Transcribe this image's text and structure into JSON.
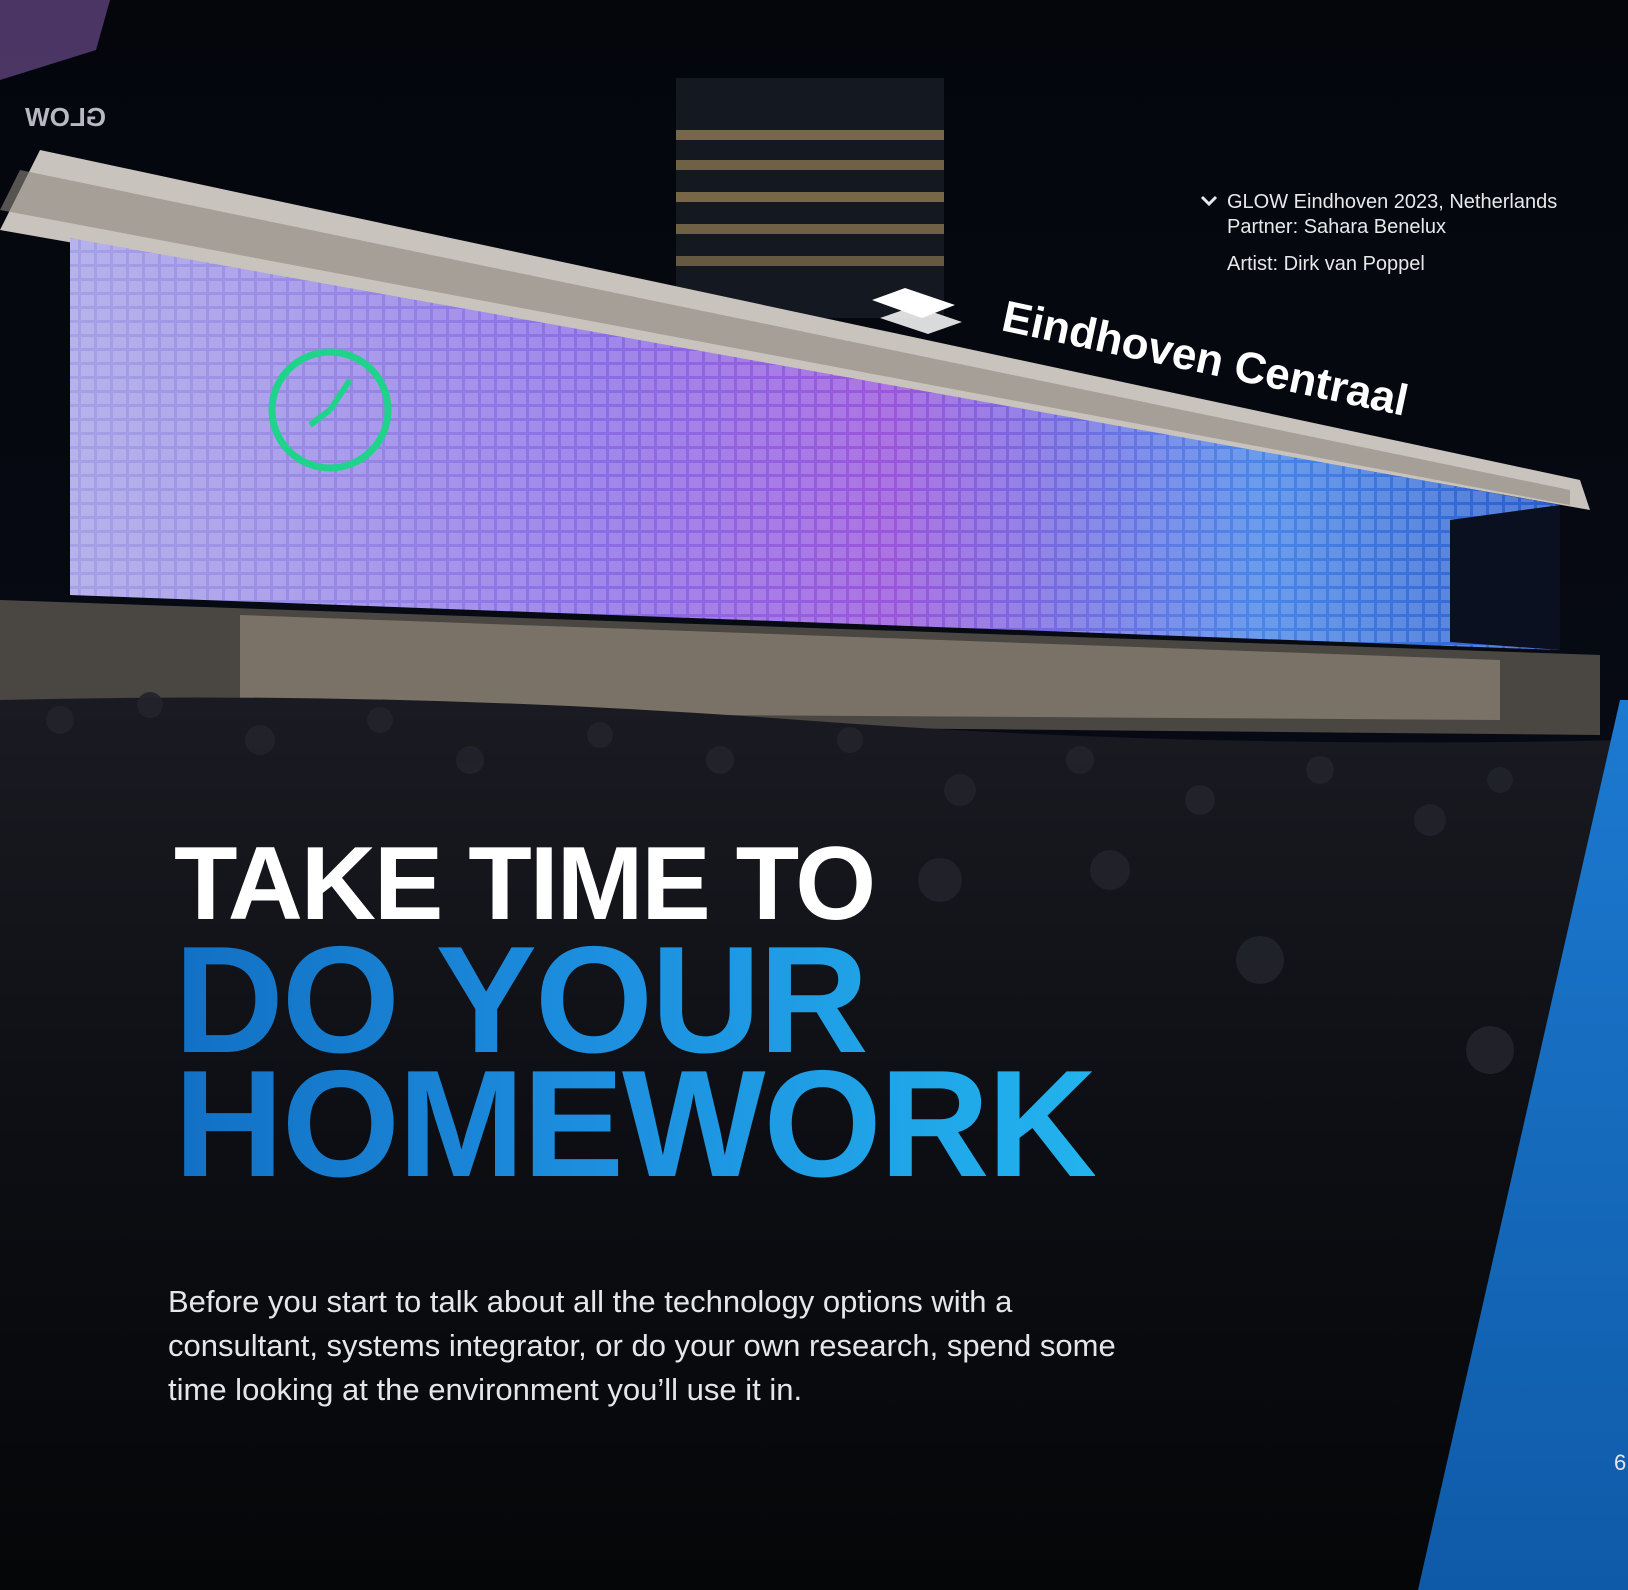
{
  "caption": {
    "line1": "GLOW Eindhoven 2023, Netherlands",
    "line2": "Partner: Sahara Benelux",
    "line3": "Artist: Dirk van Poppel"
  },
  "photo": {
    "station_sign": "Eindhoven Centraal",
    "glow_logo": "GLOW"
  },
  "headline": {
    "line1": "TAKE TIME TO",
    "line2": "DO YOUR",
    "line3": "HOMEWORK"
  },
  "body": "Before you start to talk about all the technology options with a consultant, systems integrator, or do your own research, spend some time looking at the environment you’ll use it in.",
  "page_number": "6",
  "colors": {
    "accent_blue": "#1d88d4",
    "accent_light": "#22b3ee",
    "band_blue": "#1666b8"
  },
  "icons": [
    "chevron-down-icon"
  ]
}
